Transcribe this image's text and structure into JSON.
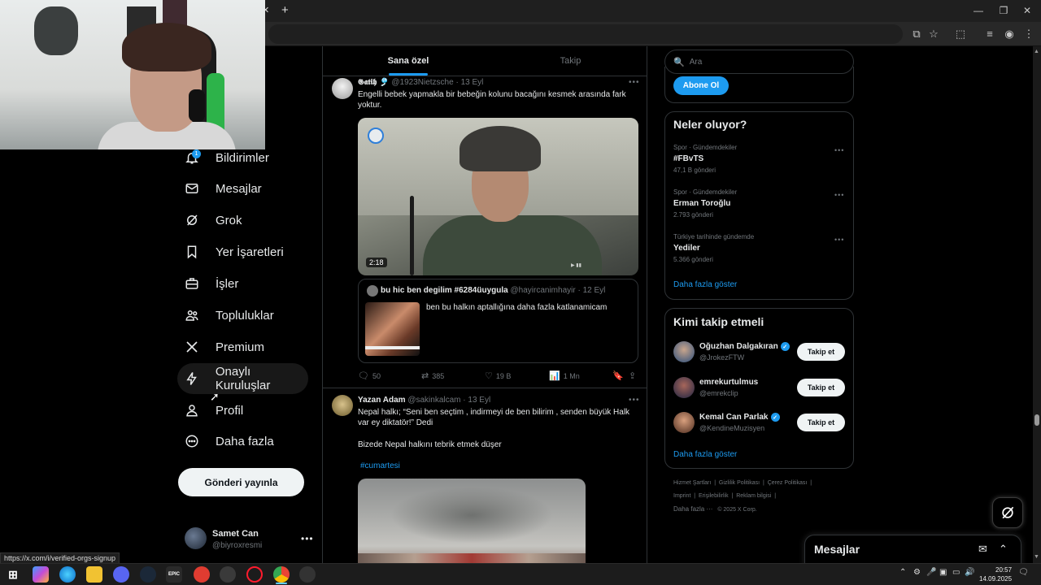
{
  "browser": {
    "window_controls": {
      "minimize": "—",
      "restore": "❐",
      "close": "✕"
    },
    "new_tab": "+",
    "tab_close": "✕"
  },
  "nav": {
    "notifications_badge": "1",
    "items": [
      {
        "label": "Bildirimler",
        "icon": "bell-icon"
      },
      {
        "label": "Mesajlar",
        "icon": "envelope-icon"
      },
      {
        "label": "Grok",
        "icon": "grok-icon"
      },
      {
        "label": "Yer İşaretleri",
        "icon": "bookmark-icon"
      },
      {
        "label": "İşler",
        "icon": "briefcase-icon"
      },
      {
        "label": "Topluluklar",
        "icon": "people-icon"
      },
      {
        "label": "Premium",
        "icon": "x-logo-icon"
      },
      {
        "label": "Onaylı Kuruluşlar",
        "icon": "lightning-icon"
      },
      {
        "label": "Profil",
        "icon": "person-icon"
      },
      {
        "label": "Daha fazla",
        "icon": "more-circle-icon"
      }
    ],
    "post_button": "Gönderi yayınla",
    "account": {
      "name": "Samet Can",
      "handle": "@biyroxresmi"
    }
  },
  "status_url": "https://x.com/i/verified-orgs-signup",
  "feed": {
    "tabs": [
      "Sana özel",
      "Takip"
    ],
    "tweets": [
      {
        "name": "𝕲𝖆𝖙𝖎𝖍 🎐",
        "handle": "@1923Nietzsche",
        "time": "13 Eyl",
        "text": "Engelli bebek yapmakla bir bebeğin kolunu bacağını kesmek arasında fark yoktur.",
        "video_duration": "2:18",
        "quote": {
          "name": "bu hic ben degilim #6284üuygula",
          "handle": "@hayircanimhayir",
          "time": "12 Eyl",
          "text": "ben bu halkın aptallığına daha fazla katlanamicam"
        },
        "actions": {
          "replies": "50",
          "reposts": "385",
          "likes": "19 B",
          "views": "1 Mn"
        }
      },
      {
        "name": "Yazan Adam",
        "handle": "@sakinkalcam",
        "time": "13 Eyl",
        "text1": "Nepal halkı; “Seni ben seçtim , indirmeyi de ben bilirim , senden büyük Halk var ey diktatör!” Dedi",
        "text2": "Bizede Nepal halkını tebrik etmek düşer",
        "hashtag": "#cumartesi"
      }
    ]
  },
  "right": {
    "search_placeholder": "Ara",
    "subscribe_button": "Abone Ol",
    "trends_title": "Neler oluyor?",
    "trends": [
      {
        "category": "Spor · Gündemdekiler",
        "name": "#FBvTS",
        "count": "47,1 B gönderi"
      },
      {
        "category": "Spor · Gündemdekiler",
        "name": "Erman Toroğlu",
        "count": "2.793 gönderi"
      },
      {
        "category": "Türkiye tarihinde gündemde",
        "name": "Yediler",
        "count": "5.366 gönderi"
      }
    ],
    "trends_show_more": "Daha fazla göster",
    "who_title": "Kimi takip etmeli",
    "who": [
      {
        "name": "Oğuzhan Dalgakıran",
        "handle": "@JrokezFTW",
        "verified": true,
        "button": "Takip et"
      },
      {
        "name": "emrekurtulmus",
        "handle": "@emrekclip",
        "verified": false,
        "button": "Takip et"
      },
      {
        "name": "Kemal Can Parlak",
        "handle": "@KendineMuzisyen",
        "verified": true,
        "button": "Takip et"
      }
    ],
    "who_show_more": "Daha fazla göster",
    "footer": {
      "row1": [
        "Hizmet Şartları",
        "|",
        "Gizlilik Politikası",
        "|",
        "Çerez Politikası",
        "|"
      ],
      "row2": [
        "Imprint",
        "|",
        "Erişilebilirlik",
        "|",
        "Reklam bilgisi",
        "|"
      ],
      "row3": [
        "Daha fazla ···",
        "© 2025 X Corp."
      ]
    }
  },
  "messages_drawer": "Mesajlar",
  "taskbar": {
    "time": "20:57",
    "date": "14.09.2025",
    "app_labels": [
      "EPIC"
    ]
  }
}
